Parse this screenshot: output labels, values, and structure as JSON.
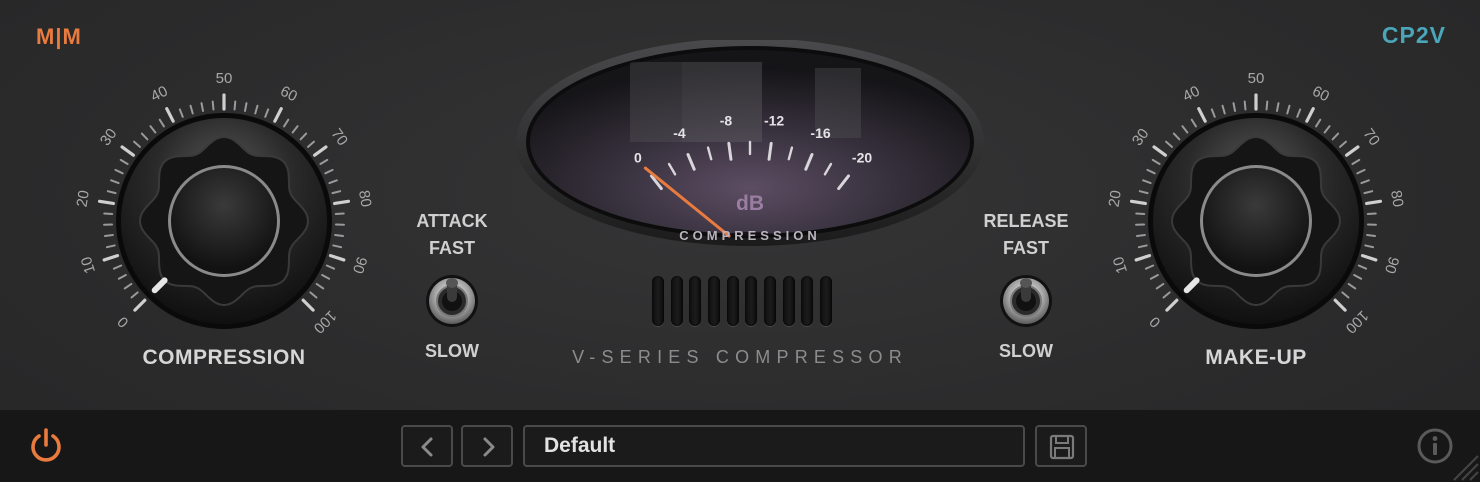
{
  "brand": {
    "logo": "M|M",
    "product": "CP2V",
    "logo_color": "#e97b3f",
    "product_color": "#4aa6b8"
  },
  "compression_knob": {
    "label": "COMPRESSION",
    "scale": [
      "0",
      "10",
      "20",
      "30",
      "40",
      "50",
      "60",
      "70",
      "80",
      "90",
      "100"
    ],
    "value": 0
  },
  "makeup_knob": {
    "label": "MAKE-UP",
    "scale": [
      "0",
      "10",
      "20",
      "30",
      "40",
      "50",
      "60",
      "70",
      "80",
      "90",
      "100"
    ],
    "value": 0
  },
  "attack": {
    "line1": "ATTACK",
    "line2": "FAST",
    "bottom": "SLOW"
  },
  "release": {
    "line1": "RELEASE",
    "line2": "FAST",
    "bottom": "SLOW"
  },
  "meter": {
    "unit": "dB",
    "caption": "COMPRESSION",
    "scale": [
      "0",
      "-4",
      "-8",
      "-12",
      "-16",
      "-20"
    ],
    "reading": 0,
    "needle_color": "#e97b3f"
  },
  "series_label": "V-SERIES COMPRESSOR",
  "footer": {
    "preset_name": "Default",
    "power_icon": "power-icon",
    "prev_icon": "chevron-left-icon",
    "next_icon": "chevron-right-icon",
    "save_icon": "save-icon",
    "info_icon": "info-icon",
    "power_color": "#e97b3f"
  }
}
